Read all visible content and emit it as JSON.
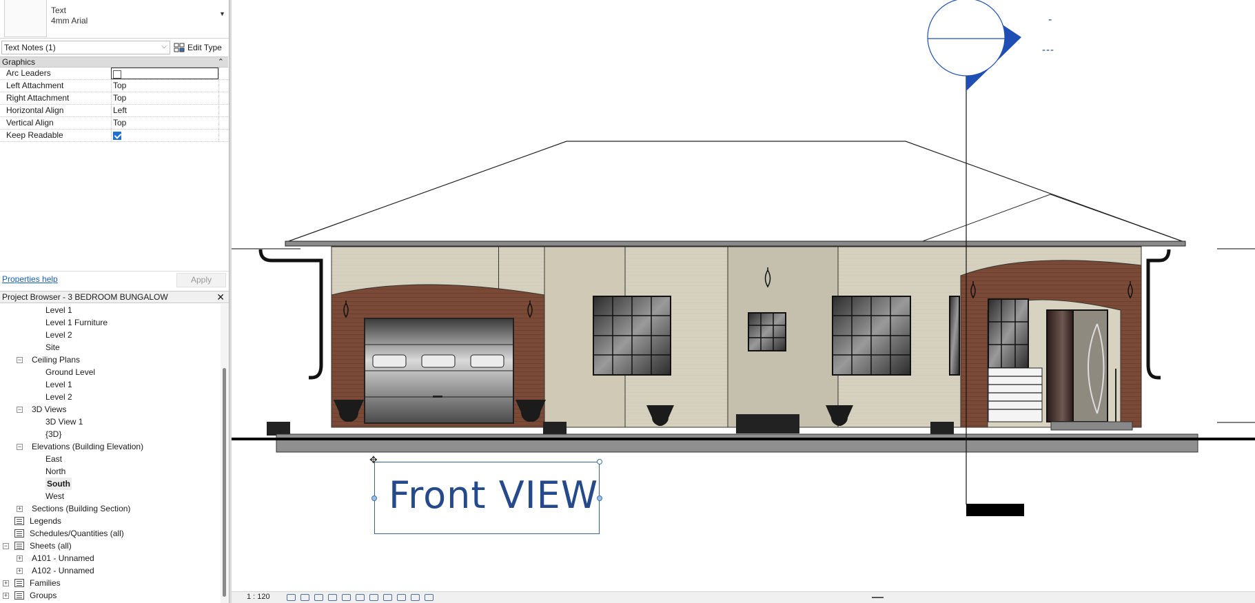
{
  "type_selector": {
    "family": "Text",
    "type": "4mm Arial"
  },
  "instance_selector": {
    "value": "Text Notes (1)",
    "edit_type_label": "Edit Type"
  },
  "properties": {
    "group": "Graphics",
    "rows": [
      {
        "name": "Arc Leaders",
        "value": "",
        "checkbox": false
      },
      {
        "name": "Left Attachment",
        "value": "Top"
      },
      {
        "name": "Right Attachment",
        "value": "Top"
      },
      {
        "name": "Horizontal Align",
        "value": "Left"
      },
      {
        "name": "Vertical Align",
        "value": "Top"
      },
      {
        "name": "Keep Readable",
        "value": "",
        "checkbox": true
      }
    ],
    "help_label": "Properties help",
    "apply_label": "Apply"
  },
  "project_browser": {
    "title": "Project Browser - 3 BEDROOM BUNGALOW",
    "nodes": [
      {
        "label": "Level 1",
        "indent": 3
      },
      {
        "label": "Level 1 Furniture",
        "indent": 3
      },
      {
        "label": "Level 2",
        "indent": 3
      },
      {
        "label": "Site",
        "indent": 3
      },
      {
        "label": "Ceiling Plans",
        "indent": 2,
        "expander": "-"
      },
      {
        "label": "Ground Level",
        "indent": 3
      },
      {
        "label": "Level 1",
        "indent": 3
      },
      {
        "label": "Level 2",
        "indent": 3
      },
      {
        "label": "3D Views",
        "indent": 2,
        "expander": "-"
      },
      {
        "label": "3D View 1",
        "indent": 3
      },
      {
        "label": "{3D}",
        "indent": 3
      },
      {
        "label": "Elevations (Building Elevation)",
        "indent": 2,
        "expander": "-"
      },
      {
        "label": "East",
        "indent": 3
      },
      {
        "label": "North",
        "indent": 3
      },
      {
        "label": "South",
        "indent": 3,
        "selected": true
      },
      {
        "label": "West",
        "indent": 3
      },
      {
        "label": "Sections (Building Section)",
        "indent": 2,
        "expander": "+"
      },
      {
        "label": "Legends",
        "indent": 1,
        "icon": true
      },
      {
        "label": "Schedules/Quantities (all)",
        "indent": 1,
        "icon": true
      },
      {
        "label": "Sheets (all)",
        "indent": 1,
        "icon": true,
        "expander": "-"
      },
      {
        "label": "A101 - Unnamed",
        "indent": 2,
        "expander": "+"
      },
      {
        "label": "A102 - Unnamed",
        "indent": 2,
        "expander": "+"
      },
      {
        "label": "Families",
        "indent": 1,
        "icon": true,
        "expander": "+"
      },
      {
        "label": "Groups",
        "indent": 1,
        "icon": true,
        "expander": "+"
      }
    ]
  },
  "canvas": {
    "view_title_text": "Front  VIEW",
    "elevation_marker": {
      "top_text": "-",
      "bottom_text": "---",
      "color": "#1f4fb4"
    }
  },
  "status_bar": {
    "scale": "1 : 120"
  },
  "colors": {
    "brick": "#7a4a36",
    "siding": "#d8d3c1",
    "roof": "#ffffff",
    "marker_blue": "#1f4fb4"
  }
}
